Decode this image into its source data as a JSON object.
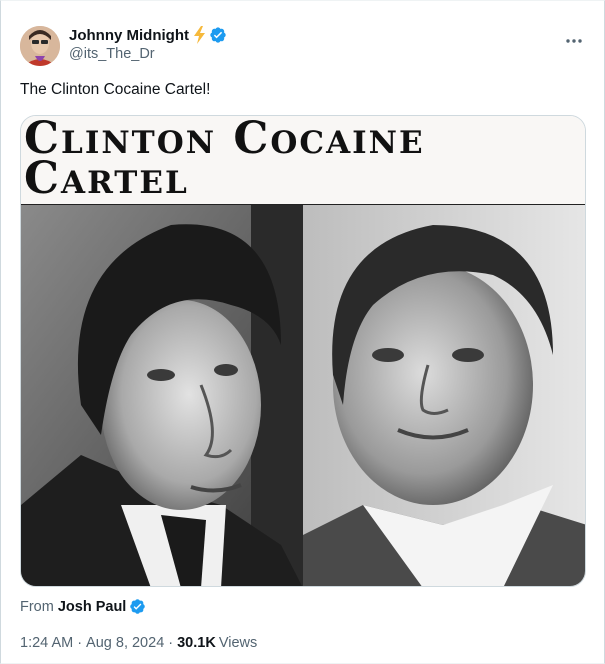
{
  "author": {
    "display_name": "Johnny Midnight",
    "handle": "@its_The_Dr"
  },
  "icons": {
    "bolt": "lightning-bolt-emoji",
    "verified": "verified-badge",
    "more": "more-options",
    "verified_color": "#1d9bf0",
    "bolt_color": "#f6b93b"
  },
  "tweet": {
    "text": "The Clinton Cocaine Cartel!"
  },
  "media": {
    "title_line1": "Clinton Cocaine",
    "title_line2": "Cartel"
  },
  "attribution": {
    "prefix": "From",
    "name": "Josh Paul"
  },
  "meta": {
    "time": "1:24 AM",
    "date": "Aug 8, 2024",
    "separator": "·",
    "views_count": "30.1K",
    "views_label": "Views"
  }
}
